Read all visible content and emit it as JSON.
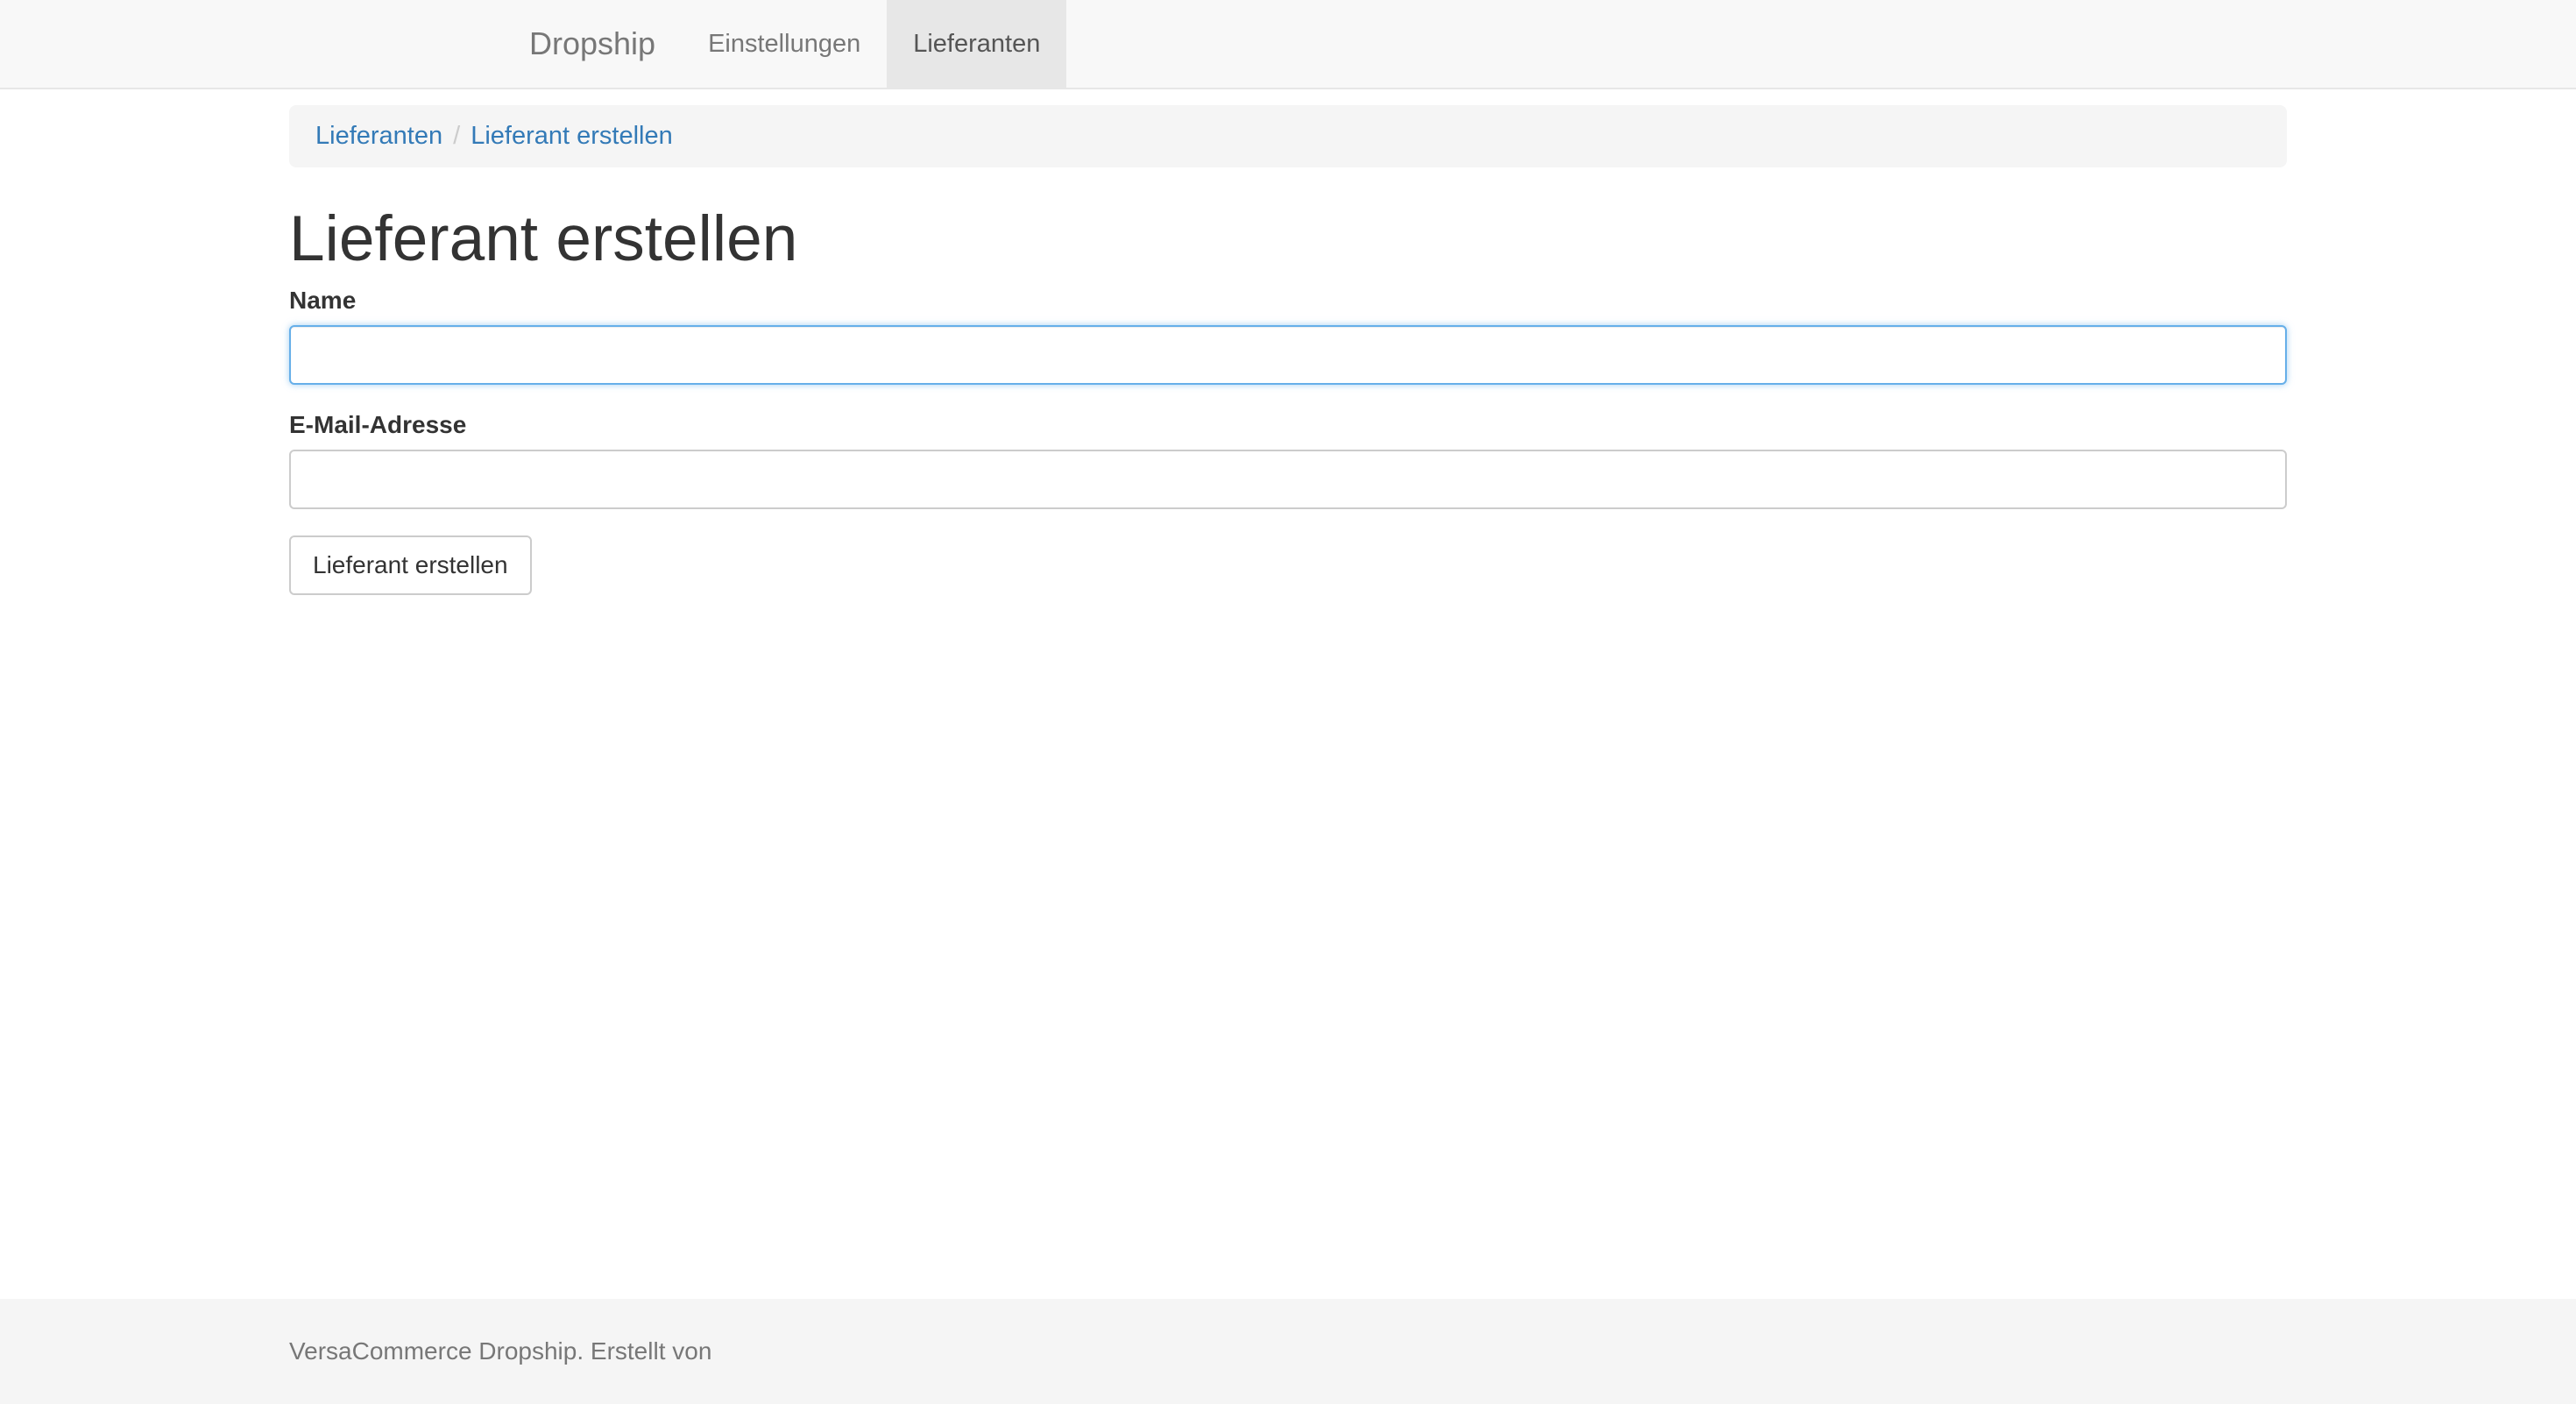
{
  "navbar": {
    "brand": "Dropship",
    "items": [
      {
        "label": "Einstellungen",
        "active": false
      },
      {
        "label": "Lieferanten",
        "active": true
      }
    ]
  },
  "breadcrumb": {
    "items": [
      "Lieferanten",
      "Lieferant erstellen"
    ],
    "separator": "/"
  },
  "page": {
    "title": "Lieferant erstellen"
  },
  "form": {
    "name_label": "Name",
    "name_value": "",
    "email_label": "E-Mail-Adresse",
    "email_value": "",
    "submit_label": "Lieferant erstellen"
  },
  "footer": {
    "text": "VersaCommerce Dropship. Erstellt von"
  },
  "colors": {
    "link": "#337ab7",
    "focus_border": "#66afe9",
    "navbar_bg": "#f8f8f8",
    "active_nav_bg": "#e7e7e7"
  }
}
